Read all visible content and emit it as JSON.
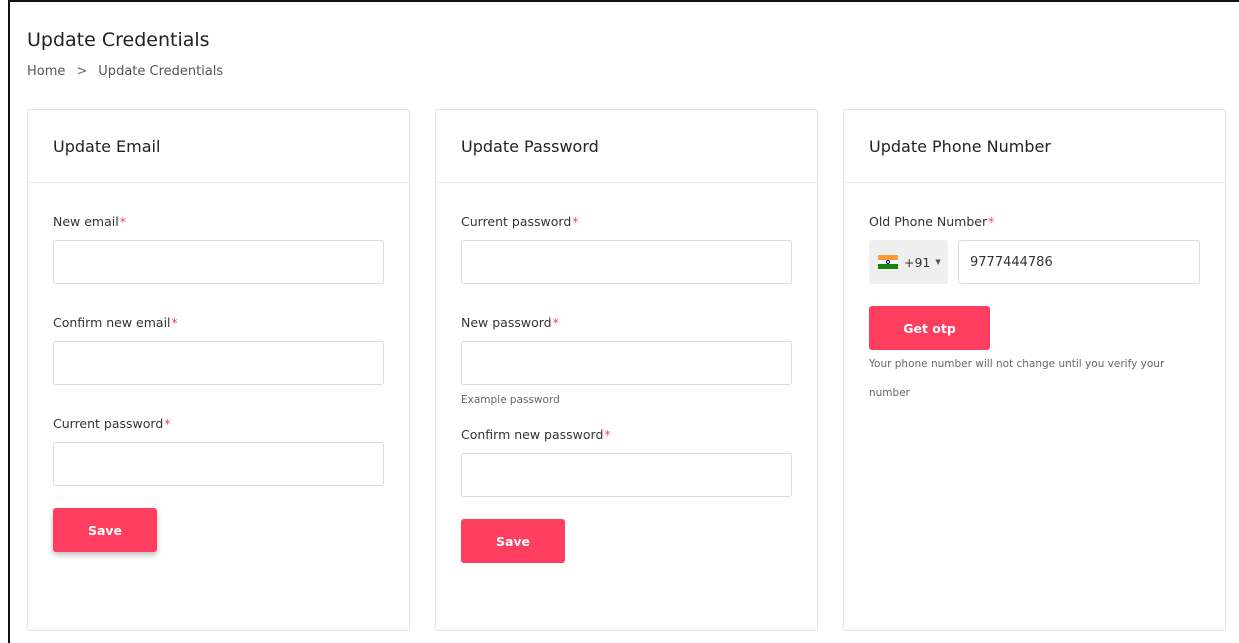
{
  "header": {
    "title": "Update Credentials",
    "breadcrumb": {
      "home": "Home",
      "separator": ">",
      "current": "Update Credentials"
    }
  },
  "email_card": {
    "title": "Update Email",
    "fields": [
      {
        "label": "New email",
        "value": ""
      },
      {
        "label": "Confirm new email",
        "value": ""
      },
      {
        "label": "Current password",
        "value": ""
      }
    ],
    "save_label": "Save"
  },
  "password_card": {
    "title": "Update Password",
    "fields": [
      {
        "label": "Current password",
        "value": ""
      },
      {
        "label": "New password",
        "value": "",
        "hint": "Example password"
      },
      {
        "label": "Confirm new password",
        "value": ""
      }
    ],
    "save_label": "Save"
  },
  "phone_card": {
    "title": "Update Phone Number",
    "label": "Old Phone Number",
    "country_code": "+91",
    "country_flag": "india-flag-icon",
    "phone_value": "9777444786",
    "otp_label": "Get otp",
    "note": "Your phone number will not change until you verify your number"
  },
  "required_marker": "*",
  "colors": {
    "accent": "#ff3d5f",
    "required": "#ff3d5f",
    "border": "#dcdcdc"
  }
}
